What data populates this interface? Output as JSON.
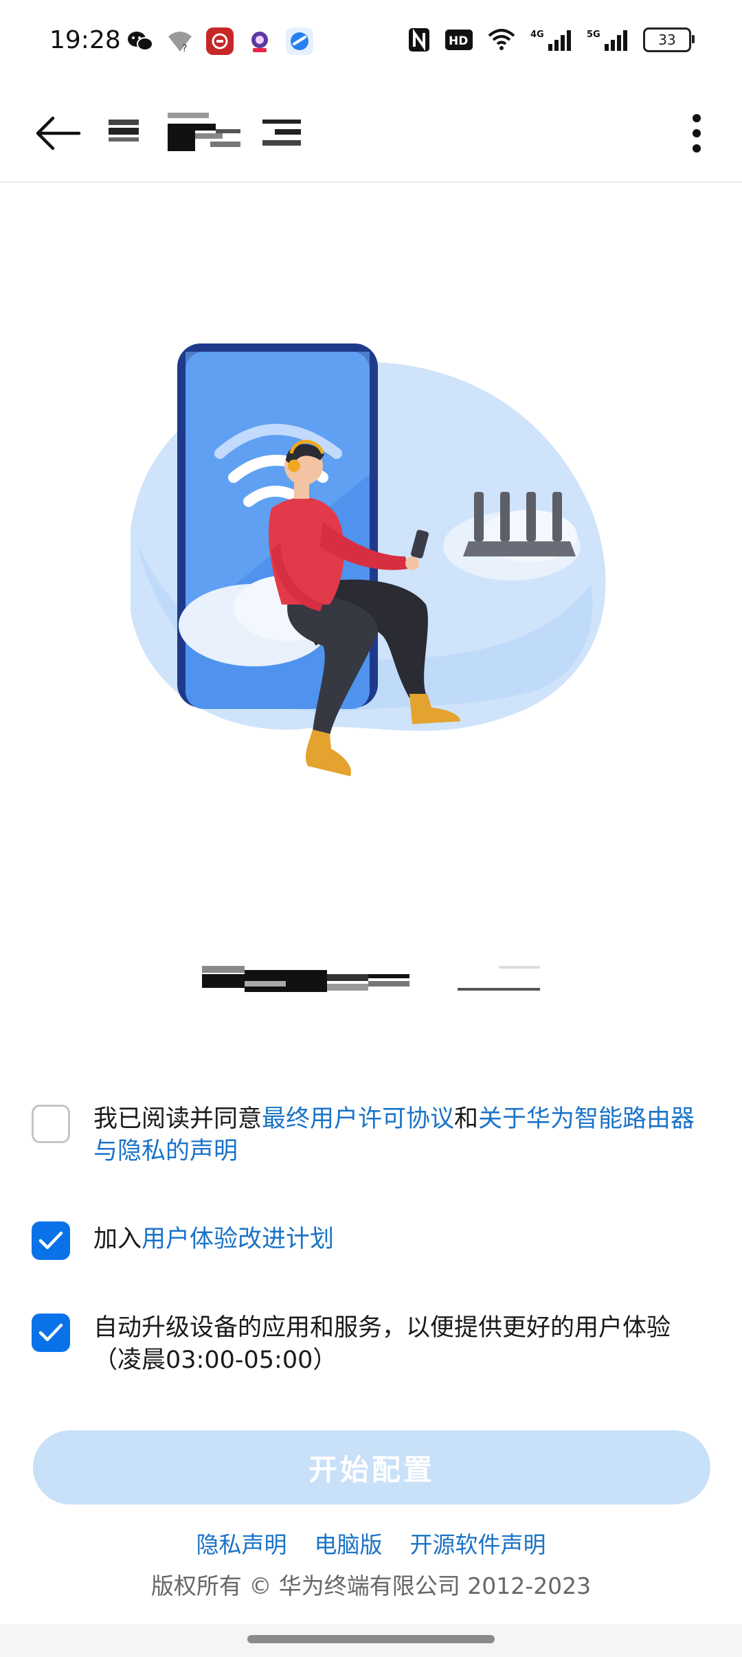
{
  "status_bar": {
    "time": "19:28",
    "battery": "33",
    "notification_icons": [
      "wechat-icon",
      "wifi-unknown-icon",
      "red-app-icon",
      "astronaut-app-icon",
      "blue-app-icon"
    ],
    "system_icons": [
      "nfc-icon",
      "hd-icon",
      "wifi-icon",
      "4g-signal-icon",
      "5g-signal-icon",
      "battery-icon"
    ],
    "hd_label": "HD",
    "net_4g": "4G",
    "net_5g": "5G"
  },
  "toolbar": {
    "back_icon": "back-arrow-icon",
    "more_icon": "more-vertical-icon"
  },
  "agreements": [
    {
      "checked": false,
      "prefix": "我已阅读并同意",
      "link1": "最终用户许可协议",
      "mid": "和",
      "link2": "关于华为智能路由器与隐私的声明"
    },
    {
      "checked": true,
      "prefix": "加入",
      "link1": "用户体验改进计划"
    },
    {
      "checked": true,
      "line1": "自动升级设备的应用和服务，以便提供更好的用户体验",
      "line2": "（凌晨03:00-05:00）"
    }
  ],
  "start_button": "开始配置",
  "footer": {
    "links": [
      "隐私声明",
      "电脑版",
      "开源软件声明"
    ],
    "copyright": "版权所有 © 华为终端有限公司 2012-2023"
  },
  "colors": {
    "accent": "#0a72e8",
    "link": "#1a73c8",
    "button_disabled": "#c8e0f8"
  }
}
